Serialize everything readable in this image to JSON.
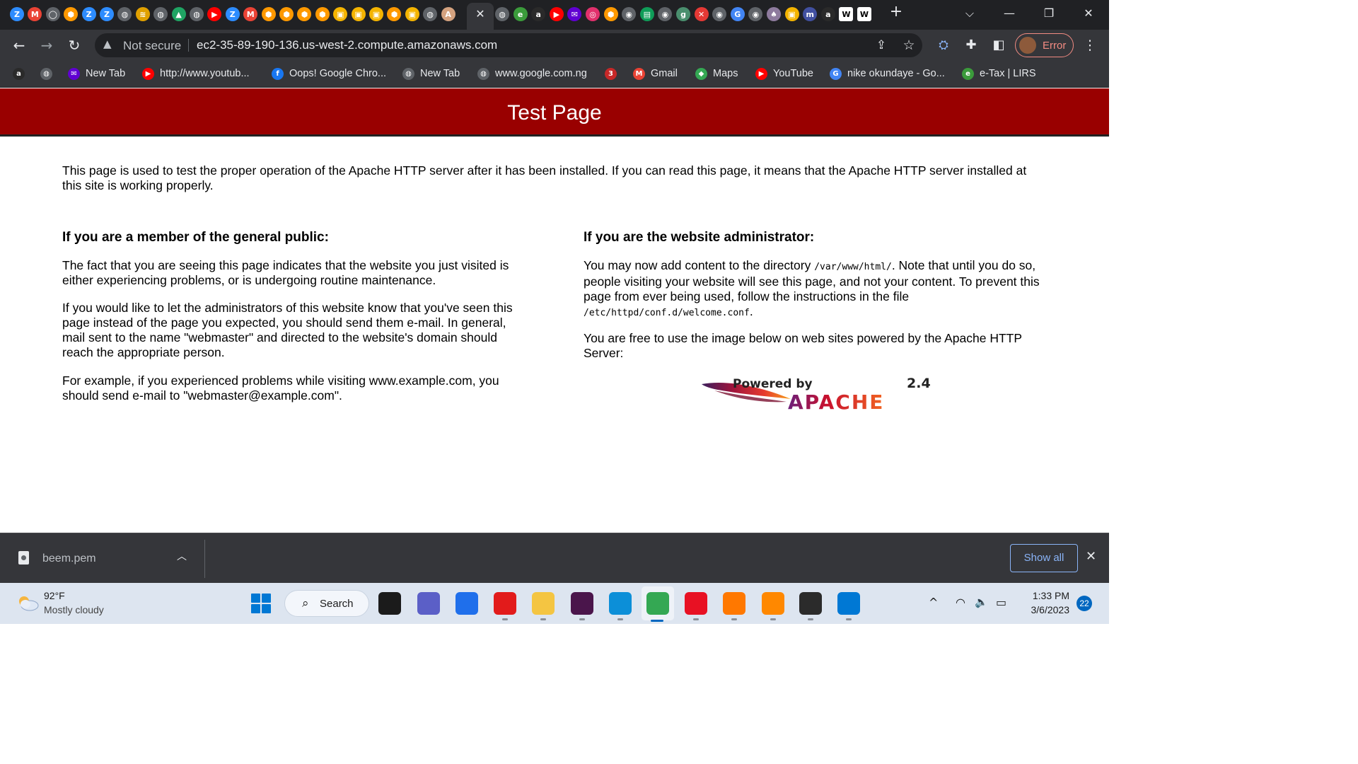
{
  "browser": {
    "active_tab_close": "✕",
    "new_tab_glyph": "+",
    "tab_list_glyph": "⌵",
    "window": {
      "minimize": "—",
      "restore": "❐",
      "close": "✕"
    },
    "tab_favicons": [
      {
        "icon": "zoom-icon",
        "glyph": "Z",
        "color": "#2d8cff"
      },
      {
        "icon": "gmail-icon",
        "glyph": "M",
        "color": "#ea4335"
      },
      {
        "icon": "github-icon",
        "glyph": "◯",
        "color": "#5f6368"
      },
      {
        "icon": "aws-cube-icon",
        "glyph": "⬢",
        "color": "#ff9900"
      },
      {
        "icon": "zoom-icon",
        "glyph": "Z",
        "color": "#2d8cff"
      },
      {
        "icon": "zoom-icon",
        "glyph": "Z",
        "color": "#2d8cff"
      },
      {
        "icon": "globe-icon",
        "glyph": "◍",
        "color": "#5f6368"
      },
      {
        "icon": "layers-icon",
        "glyph": "≋",
        "color": "#e0a000"
      },
      {
        "icon": "globe-icon",
        "glyph": "◍",
        "color": "#5f6368"
      },
      {
        "icon": "google-drive-icon",
        "glyph": "▲",
        "color": "#1fa463"
      },
      {
        "icon": "globe-icon",
        "glyph": "◍",
        "color": "#5f6368"
      },
      {
        "icon": "youtube-icon",
        "glyph": "▶",
        "color": "#ff0000"
      },
      {
        "icon": "zoom-icon",
        "glyph": "Z",
        "color": "#2d8cff"
      },
      {
        "icon": "gmail-icon",
        "glyph": "M",
        "color": "#ea4335"
      },
      {
        "icon": "aws-cube-icon",
        "glyph": "⬢",
        "color": "#ff9900"
      },
      {
        "icon": "aws-cube-icon",
        "glyph": "⬢",
        "color": "#ff9900"
      },
      {
        "icon": "aws-cube-icon",
        "glyph": "⬢",
        "color": "#ff9900"
      },
      {
        "icon": "aws-cube-icon",
        "glyph": "⬢",
        "color": "#ff9900"
      },
      {
        "icon": "box-icon",
        "glyph": "▣",
        "color": "#f4b400"
      },
      {
        "icon": "box-icon",
        "glyph": "▣",
        "color": "#f4b400"
      },
      {
        "icon": "box-icon",
        "glyph": "▣",
        "color": "#f4b400"
      },
      {
        "icon": "aws-cube-icon",
        "glyph": "⬢",
        "color": "#ff9900"
      },
      {
        "icon": "box-icon",
        "glyph": "▣",
        "color": "#f4b400"
      },
      {
        "icon": "globe-icon",
        "glyph": "◍",
        "color": "#5f6368"
      },
      {
        "icon": "anthropic-icon",
        "glyph": "A",
        "color": "#d4a27f"
      }
    ],
    "tab_favicons_right": [
      {
        "icon": "globe-icon",
        "glyph": "◍",
        "color": "#5f6368"
      },
      {
        "icon": "etax-icon",
        "glyph": "e",
        "color": "#3b9b3b"
      },
      {
        "icon": "alx-icon",
        "glyph": "a",
        "color": "#2a2a2a"
      },
      {
        "icon": "youtube-icon",
        "glyph": "▶",
        "color": "#ff0000"
      },
      {
        "icon": "yahoo-mail-icon",
        "glyph": "✉",
        "color": "#6001d2"
      },
      {
        "icon": "instagram-icon",
        "glyph": "◎",
        "color": "#e1306c"
      },
      {
        "icon": "aws-cube-icon",
        "glyph": "⬢",
        "color": "#ff9900"
      },
      {
        "icon": "chrome-icon",
        "glyph": "◉",
        "color": "#5f6368"
      },
      {
        "icon": "sheets-icon",
        "glyph": "▤",
        "color": "#0f9d58"
      },
      {
        "icon": "chrome-icon",
        "glyph": "◉",
        "color": "#5f6368"
      },
      {
        "icon": "g-icon",
        "glyph": "g",
        "color": "#4a8f6e"
      },
      {
        "icon": "x-red-icon",
        "glyph": "✕",
        "color": "#e53935"
      },
      {
        "icon": "chrome-icon",
        "glyph": "◉",
        "color": "#5f6368"
      },
      {
        "icon": "google-icon",
        "glyph": "G",
        "color": "#4285f4"
      },
      {
        "icon": "chrome-icon",
        "glyph": "◉",
        "color": "#5f6368"
      },
      {
        "icon": "bottle-icon",
        "glyph": "♠",
        "color": "#8e7b9e"
      },
      {
        "icon": "box-icon",
        "glyph": "▣",
        "color": "#f4b400"
      },
      {
        "icon": "m-icon",
        "glyph": "m",
        "color": "#4150a0"
      },
      {
        "icon": "alx-icon",
        "glyph": "a",
        "color": "#2a2a2a"
      },
      {
        "icon": "wikipedia-icon",
        "glyph": "W",
        "color": "#ffffff"
      },
      {
        "icon": "wikipedia-icon",
        "glyph": "W",
        "color": "#ffffff"
      }
    ],
    "toolbar": {
      "back": "←",
      "forward": "→",
      "reload": "↻",
      "security_glyph": "▲",
      "security_label": "Not secure",
      "url": "ec2-35-89-190-136.us-west-2.compute.amazonaws.com",
      "share": "⇪",
      "star": "☆",
      "ext1": "⛭",
      "extensions": "✚",
      "sidepanel": "◧",
      "profile_label": "Error",
      "menu": "⋮"
    },
    "bookmarks": [
      {
        "label": "",
        "icon": "alx-icon",
        "glyph": "a",
        "color": "#2a2a2a"
      },
      {
        "label": "",
        "icon": "globe-icon",
        "glyph": "◍",
        "color": "#5f6368"
      },
      {
        "label": "New Tab",
        "icon": "yahoo-mail-icon",
        "glyph": "✉",
        "color": "#6001d2"
      },
      {
        "label": "http://www.youtub...",
        "icon": "youtube-icon",
        "glyph": "▶",
        "color": "#ff0000"
      },
      {
        "label": "Oops! Google Chro...",
        "icon": "facebook-icon",
        "glyph": "f",
        "color": "#1877f2"
      },
      {
        "label": "New Tab",
        "icon": "globe-icon",
        "glyph": "◍",
        "color": "#5f6368"
      },
      {
        "label": "www.google.com.ng",
        "icon": "globe-icon",
        "glyph": "◍",
        "color": "#5f6368"
      },
      {
        "label": "",
        "icon": "channel3-icon",
        "glyph": "3",
        "color": "#c62828"
      },
      {
        "label": "Gmail",
        "icon": "gmail-icon",
        "glyph": "M",
        "color": "#ea4335"
      },
      {
        "label": "Maps",
        "icon": "maps-pin-icon",
        "glyph": "◆",
        "color": "#34a853"
      },
      {
        "label": "YouTube",
        "icon": "youtube-icon",
        "glyph": "▶",
        "color": "#ff0000"
      },
      {
        "label": "nike okundaye - Go...",
        "icon": "google-icon",
        "glyph": "G",
        "color": "#4285f4"
      },
      {
        "label": "e-Tax | LIRS",
        "icon": "etax-icon",
        "glyph": "e",
        "color": "#3b9b3b"
      }
    ]
  },
  "page": {
    "title": "Test Page",
    "intro": "This page is used to test the proper operation of the Apache HTTP server after it has been installed. If you can read this page, it means that the Apache HTTP server installed at this site is working properly.",
    "public": {
      "heading": "If you are a member of the general public:",
      "p1": "The fact that you are seeing this page indicates that the website you just visited is either experiencing problems, or is undergoing routine maintenance.",
      "p2": "If you would like to let the administrators of this website know that you've seen this page instead of the page you expected, you should send them e-mail. In general, mail sent to the name \"webmaster\" and directed to the website's domain should reach the appropriate person.",
      "p3": "For example, if you experienced problems while visiting www.example.com, you should send e-mail to \"webmaster@example.com\"."
    },
    "admin": {
      "heading": "If you are the website administrator:",
      "p1_a": "You may now add content to the directory ",
      "p1_code1": "/var/www/html/",
      "p1_b": ". Note that until you do so, people visiting your website will see this page, and not your content. To prevent this page from ever being used, follow the instructions in the file ",
      "p1_code2": "/etc/httpd/conf.d/welcome.conf",
      "p1_c": ".",
      "p2": "You are free to use the image below on web sites powered by the Apache HTTP Server:",
      "logo_powered": "Powered by",
      "logo_version": "2.4",
      "logo_name": "APACHE"
    }
  },
  "download_bar": {
    "file_name": "beem.pem",
    "chevron": "︿",
    "show_all": "Show all",
    "close": "✕"
  },
  "taskbar": {
    "weather_temp": "92°F",
    "weather_desc": "Mostly cloudy",
    "search_icon": "⌕",
    "search_label": "Search",
    "apps": [
      {
        "name": "task-view-icon",
        "color": "#1b1b1b"
      },
      {
        "name": "teams-chat-icon",
        "color": "#5b5fc7"
      },
      {
        "name": "microsoft-store-icon",
        "color": "#1f6feb"
      },
      {
        "name": "opera-icon",
        "color": "#e21b1b"
      },
      {
        "name": "file-explorer-icon",
        "color": "#f4c542"
      },
      {
        "name": "slack-icon",
        "color": "#4a154b"
      },
      {
        "name": "edge-icon",
        "color": "#0c8fd8"
      },
      {
        "name": "chrome-icon",
        "color": "#34a853"
      },
      {
        "name": "media-player-icon",
        "color": "#e81123"
      },
      {
        "name": "avast-icon",
        "color": "#ff7800"
      },
      {
        "name": "vlc-icon",
        "color": "#ff8800"
      },
      {
        "name": "terminal-icon",
        "color": "#2b2b2b"
      },
      {
        "name": "vscode-icon",
        "color": "#0078d4"
      }
    ],
    "tray_chevron": "^",
    "wifi": "◠",
    "volume": "🔈",
    "battery": "▭",
    "time": "1:33 PM",
    "date": "3/6/2023",
    "notifications": "22"
  }
}
